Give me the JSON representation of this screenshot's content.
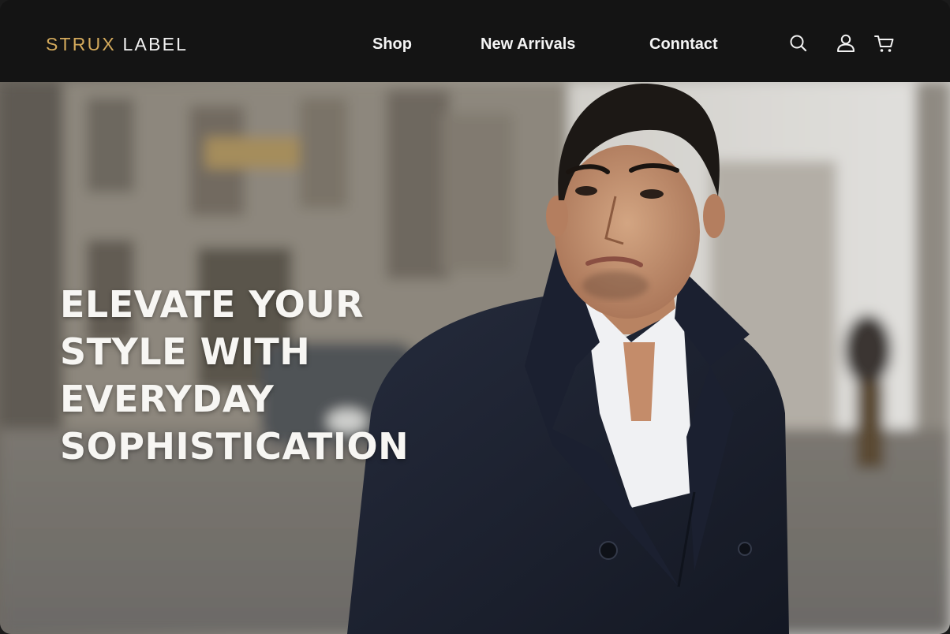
{
  "brand": {
    "part1": "STRUX",
    "part2": "LABEL",
    "accent_color": "#d4aa5c"
  },
  "nav": {
    "items": [
      {
        "label": "Shop"
      },
      {
        "label": "New Arrivals"
      },
      {
        "label": "Conntact"
      }
    ]
  },
  "header_icons": [
    "search-icon",
    "user-icon",
    "cart-icon"
  ],
  "hero": {
    "title_lines": [
      "ELEVATE YOUR",
      "STYLE WITH",
      "EVERYDAY",
      "SOPHISTICATION"
    ],
    "image": "man-in-navy-peacoat-on-city-street"
  },
  "colors": {
    "header_bg": "#141414",
    "text_light": "#f4f4f4",
    "coat_navy": "#1c2233"
  }
}
